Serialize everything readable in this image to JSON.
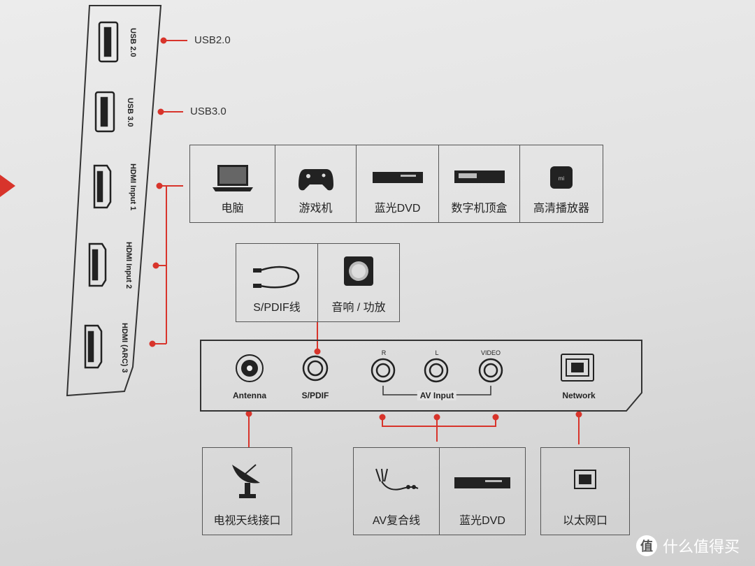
{
  "colors": {
    "accent": "#d8342b",
    "line": "#555555",
    "background": "#e2e2e2"
  },
  "side_panel": {
    "ports": [
      {
        "label": "USB 2.0",
        "icon": "usb-port-icon"
      },
      {
        "label": "USB 3.0",
        "icon": "usb-port-icon"
      },
      {
        "label": "HDMI Input 1",
        "icon": "hdmi-port-icon"
      },
      {
        "label": "HDMI Input 2",
        "icon": "hdmi-port-icon"
      },
      {
        "label": "HDMI (ARC) 3",
        "icon": "hdmi-port-icon"
      }
    ],
    "callouts": {
      "usb2": "USB2.0",
      "usb3": "USB3.0"
    }
  },
  "hdmi_devices": [
    {
      "label": "电脑",
      "icon": "laptop-icon"
    },
    {
      "label": "游戏机",
      "icon": "gamepad-icon"
    },
    {
      "label": "蓝光DVD",
      "icon": "dvd-player-icon"
    },
    {
      "label": "数字机顶盒",
      "icon": "set-top-box-icon"
    },
    {
      "label": "高清播放器",
      "icon": "media-player-icon"
    }
  ],
  "audio_devices": [
    {
      "label": "S/PDIF线",
      "icon": "cable-icon"
    },
    {
      "label": "音响 / 功放",
      "icon": "speaker-icon"
    }
  ],
  "back_panel": {
    "antenna": "Antenna",
    "spdif": "S/PDIF",
    "av_r": "R",
    "av_l": "L",
    "av_video": "VIDEO",
    "av_input": "AV Input",
    "network": "Network"
  },
  "bottom_devices": {
    "antenna": {
      "label": "电视天线接口",
      "icon": "satellite-dish-icon"
    },
    "av": [
      {
        "label": "AV复合线",
        "icon": "av-cable-icon"
      },
      {
        "label": "蓝光DVD",
        "icon": "dvd-player-icon"
      }
    ],
    "network": {
      "label": "以太网口",
      "icon": "ethernet-port-icon"
    }
  },
  "watermark": {
    "badge": "值",
    "text": "什么值得买"
  }
}
